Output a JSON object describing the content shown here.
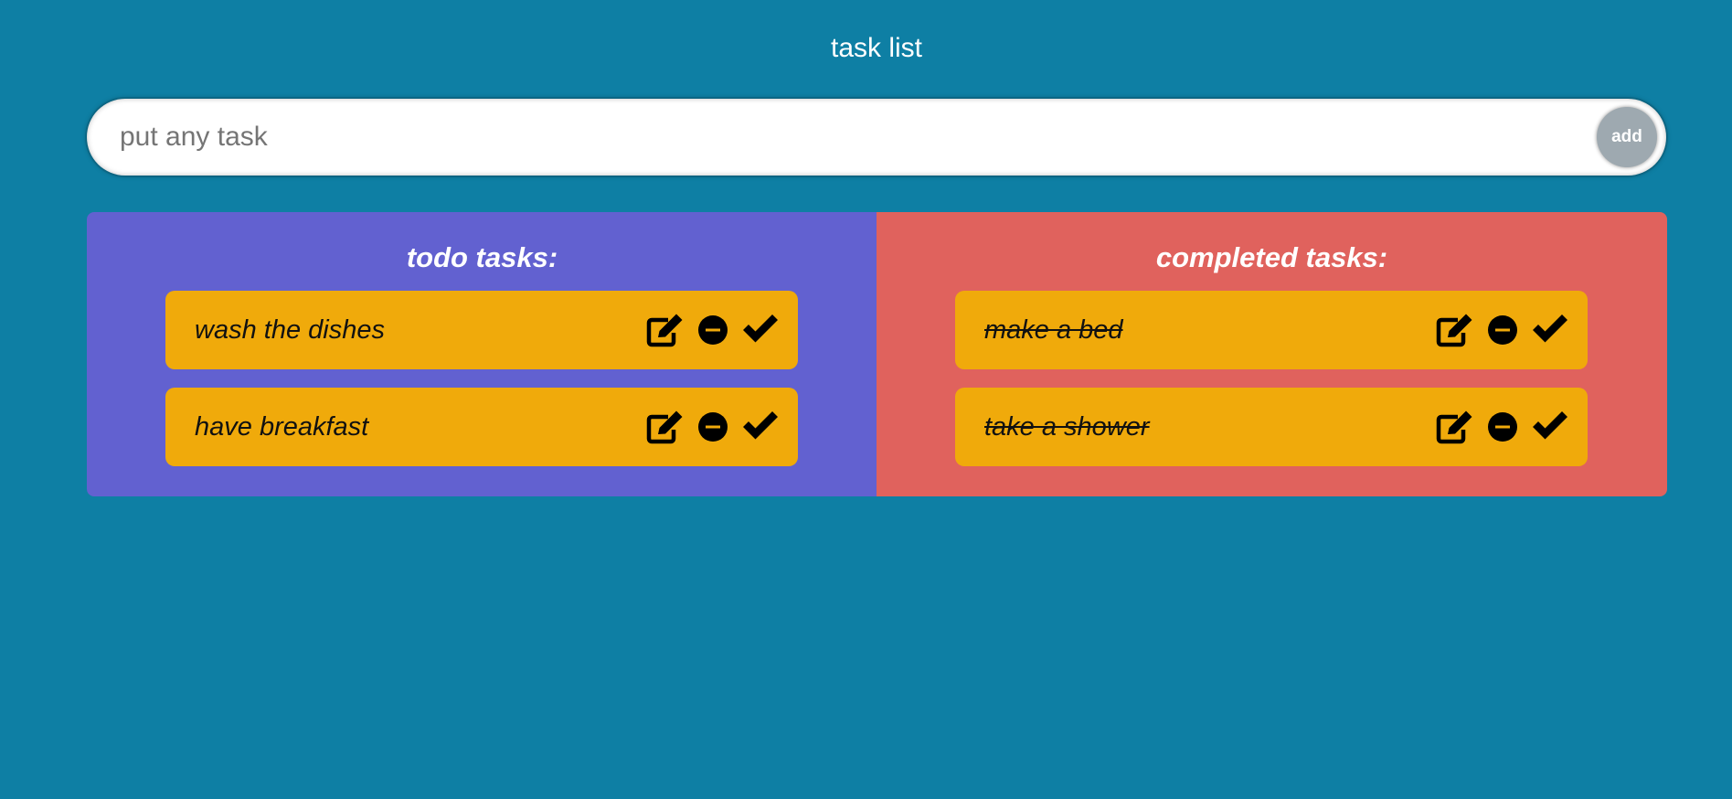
{
  "colors": {
    "background": "#0e7fa4",
    "todo_panel": "#6261d0",
    "done_panel": "#e0625d",
    "task_card": "#f0aa0b",
    "add_button": "#9ea9b0",
    "icon": "#000000"
  },
  "header": {
    "title": "task list"
  },
  "input": {
    "placeholder": "put any task",
    "value": "",
    "add_label": "add"
  },
  "todo": {
    "heading": "todo tasks:",
    "tasks": [
      {
        "text": "wash the dishes",
        "icons": [
          "edit-icon",
          "remove-icon",
          "check-icon"
        ]
      },
      {
        "text": "have breakfast",
        "icons": [
          "edit-icon",
          "remove-icon",
          "check-icon"
        ]
      }
    ]
  },
  "completed": {
    "heading": "completed tasks:",
    "tasks": [
      {
        "text": "make a bed",
        "icons": [
          "edit-icon",
          "remove-icon",
          "check-icon"
        ]
      },
      {
        "text": "take a shower",
        "icons": [
          "edit-icon",
          "remove-icon",
          "check-icon"
        ]
      }
    ]
  }
}
